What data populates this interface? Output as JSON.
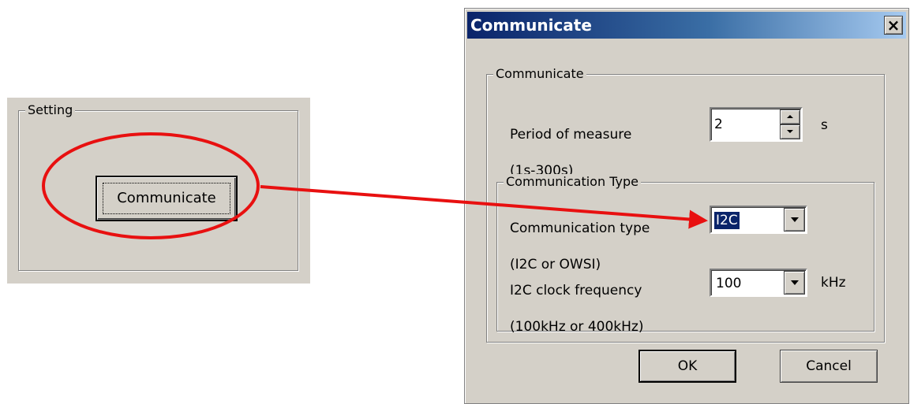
{
  "setting_panel": {
    "group_label": "Setting",
    "button_label": "Communicate"
  },
  "dialog": {
    "title": "Communicate",
    "close_glyph": "×",
    "group_label": "Communicate",
    "period": {
      "label_line1": "Period of measure",
      "label_line2": "(1s-300s)",
      "value": "2",
      "unit": "s"
    },
    "type_group": {
      "label": "Communication Type",
      "comm_type": {
        "label_line1": "Communication type",
        "label_line2": "(I2C or OWSI)",
        "value": "I2C"
      },
      "clock": {
        "label_line1": "I2C clock frequency",
        "label_line2": "(100kHz or 400kHz)",
        "value": "100",
        "unit": "kHz"
      }
    },
    "ok_label": "OK",
    "cancel_label": "Cancel"
  },
  "annotation": {
    "color": "#e81010",
    "highlight": "ellipse",
    "arrow": "communicate-button-to-communication-type-combo"
  }
}
